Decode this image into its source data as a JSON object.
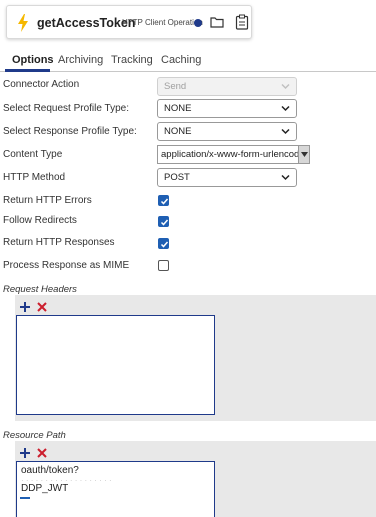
{
  "header": {
    "title": "getAccessToken",
    "operation_type": "HTTP Client Operation"
  },
  "tabs": [
    {
      "label": "Options",
      "active": true
    },
    {
      "label": "Archiving",
      "active": false
    },
    {
      "label": "Tracking",
      "active": false
    },
    {
      "label": "Caching",
      "active": false
    }
  ],
  "form": {
    "connector_action": {
      "label": "Connector Action",
      "value": "Send",
      "disabled": true
    },
    "request_profile_type": {
      "label": "Select Request Profile Type:",
      "value": "NONE"
    },
    "response_profile_type": {
      "label": "Select Response Profile Type:",
      "value": "NONE"
    },
    "content_type": {
      "label": "Content Type",
      "value": "application/x-www-form-urlencoded"
    },
    "http_method": {
      "label": "HTTP Method",
      "value": "POST"
    },
    "return_http_errors": {
      "label": "Return HTTP Errors",
      "checked": true
    },
    "follow_redirects": {
      "label": "Follow Redirects",
      "checked": true
    },
    "return_http_responses": {
      "label": "Return HTTP Responses",
      "checked": true
    },
    "process_response_mime": {
      "label": "Process Response as MIME",
      "checked": false
    }
  },
  "request_headers": {
    "label": "Request Headers",
    "items": []
  },
  "resource_path": {
    "label": "Resource Path",
    "items": [
      "oauth/token?",
      "DDP_JWT"
    ]
  },
  "colors": {
    "accent": "#1f3a8a",
    "checkbox": "#1f5fb3",
    "delete": "#cc1f2e",
    "panel_bg": "#e8e8e8",
    "bolt": "#f5b800"
  }
}
